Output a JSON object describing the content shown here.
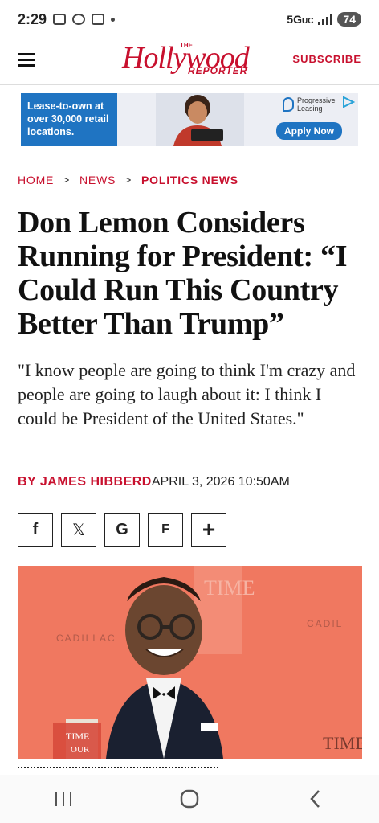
{
  "status_bar": {
    "time": "2:29",
    "network": "5G",
    "network_sub": "UC",
    "battery": "74"
  },
  "header": {
    "logo_the": "THE",
    "logo_main": "Hollywood",
    "logo_reporter": "REPORTER",
    "subscribe": "SUBSCRIBE"
  },
  "ad": {
    "lease_text": "Lease-to-own at over 30,000 retail locations.",
    "brand_line1": "Progressive",
    "brand_line2": "Leasing",
    "cta": "Apply Now",
    "accent": "#1f74c2"
  },
  "breadcrumb": {
    "home": "HOME",
    "news": "NEWS",
    "current": "POLITICS NEWS",
    "separator": ">"
  },
  "article": {
    "title": "Don Lemon Considers Running for President: “I Could Run This Country Better Than Trump”",
    "dek": "\"I know people are going to think I'm crazy and people are going to laugh about it: I think I could be President of the United States.\"",
    "byline_prefix": "BY ",
    "author": "JAMES HIBBERD",
    "date": "APRIL 3, 2026 10:50AM"
  },
  "share": [
    {
      "icon": "facebook-icon",
      "glyph": "f"
    },
    {
      "icon": "x-icon",
      "glyph": "𝕏"
    },
    {
      "icon": "google-icon",
      "glyph": "G"
    },
    {
      "icon": "flipboard-icon",
      "glyph": "F"
    },
    {
      "icon": "plus-icon",
      "glyph": "+"
    }
  ],
  "photo": {
    "backdrop_left": "CADILLAC",
    "backdrop_right": "CADIL",
    "backdrop_time": "TIME",
    "book_label": "TIME",
    "book_label2": "OUR"
  },
  "colors": {
    "brand_red": "#c8102e",
    "photo_bg": "#f07860"
  }
}
